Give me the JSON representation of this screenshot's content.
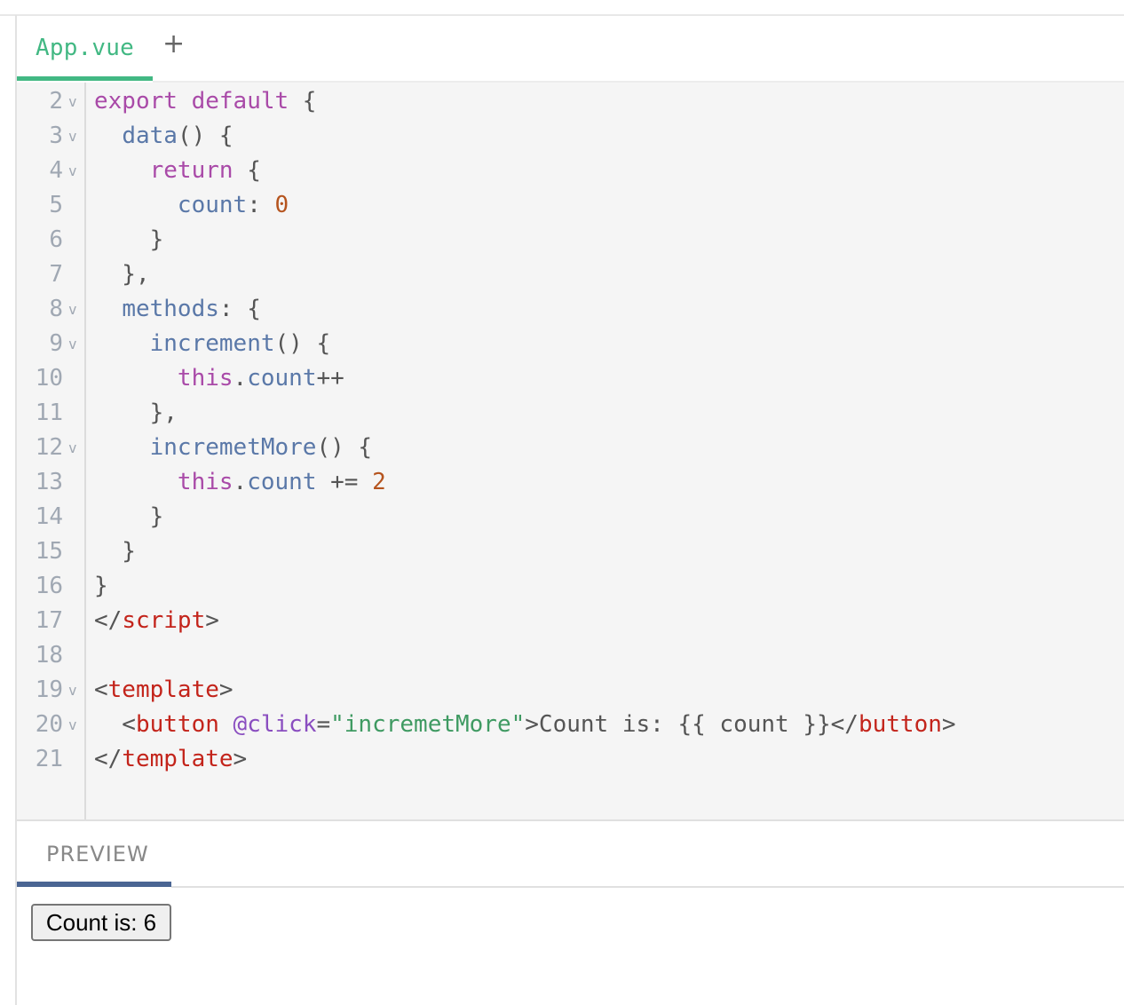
{
  "tabs": {
    "file_label": "App.vue",
    "add_label": "+"
  },
  "editor": {
    "lines": [
      {
        "num": "2",
        "fold": "v",
        "tokens": [
          [
            "kw",
            "export"
          ],
          [
            "p",
            " "
          ],
          [
            "kw",
            "default"
          ],
          [
            "p",
            " {"
          ]
        ]
      },
      {
        "num": "3",
        "fold": "v",
        "tokens": [
          [
            "p",
            "  "
          ],
          [
            "fn",
            "data"
          ],
          [
            "p",
            "() {"
          ]
        ]
      },
      {
        "num": "4",
        "fold": "v",
        "tokens": [
          [
            "p",
            "    "
          ],
          [
            "kw",
            "return"
          ],
          [
            "p",
            " {"
          ]
        ]
      },
      {
        "num": "5",
        "fold": "",
        "tokens": [
          [
            "p",
            "      "
          ],
          [
            "fn",
            "count"
          ],
          [
            "p",
            ": "
          ],
          [
            "num",
            "0"
          ]
        ]
      },
      {
        "num": "6",
        "fold": "",
        "tokens": [
          [
            "p",
            "    }"
          ]
        ]
      },
      {
        "num": "7",
        "fold": "",
        "tokens": [
          [
            "p",
            "  },"
          ]
        ]
      },
      {
        "num": "8",
        "fold": "v",
        "tokens": [
          [
            "p",
            "  "
          ],
          [
            "fn",
            "methods"
          ],
          [
            "p",
            ": {"
          ]
        ]
      },
      {
        "num": "9",
        "fold": "v",
        "tokens": [
          [
            "p",
            "    "
          ],
          [
            "fn",
            "increment"
          ],
          [
            "p",
            "() {"
          ]
        ]
      },
      {
        "num": "10",
        "fold": "",
        "tokens": [
          [
            "p",
            "      "
          ],
          [
            "kw",
            "this"
          ],
          [
            "p",
            "."
          ],
          [
            "fn",
            "count"
          ],
          [
            "p",
            "++"
          ]
        ]
      },
      {
        "num": "11",
        "fold": "",
        "tokens": [
          [
            "p",
            "    },"
          ]
        ]
      },
      {
        "num": "12",
        "fold": "v",
        "tokens": [
          [
            "p",
            "    "
          ],
          [
            "fn",
            "incremetMore"
          ],
          [
            "p",
            "() {"
          ]
        ]
      },
      {
        "num": "13",
        "fold": "",
        "tokens": [
          [
            "p",
            "      "
          ],
          [
            "kw",
            "this"
          ],
          [
            "p",
            "."
          ],
          [
            "fn",
            "count"
          ],
          [
            "p",
            " += "
          ],
          [
            "num",
            "2"
          ]
        ]
      },
      {
        "num": "14",
        "fold": "",
        "tokens": [
          [
            "p",
            "    }"
          ]
        ]
      },
      {
        "num": "15",
        "fold": "",
        "tokens": [
          [
            "p",
            "  }"
          ]
        ]
      },
      {
        "num": "16",
        "fold": "",
        "tokens": [
          [
            "p",
            "}"
          ]
        ]
      },
      {
        "num": "17",
        "fold": "",
        "tokens": [
          [
            "p",
            "</"
          ],
          [
            "tag",
            "script"
          ],
          [
            "p",
            ">"
          ]
        ]
      },
      {
        "num": "18",
        "fold": "",
        "tokens": []
      },
      {
        "num": "19",
        "fold": "v",
        "tokens": [
          [
            "p",
            "<"
          ],
          [
            "tag",
            "template"
          ],
          [
            "p",
            ">"
          ]
        ]
      },
      {
        "num": "20",
        "fold": "v",
        "tokens": [
          [
            "p",
            "  <"
          ],
          [
            "tag",
            "button"
          ],
          [
            "p",
            " "
          ],
          [
            "attr",
            "@click"
          ],
          [
            "p",
            "="
          ],
          [
            "str",
            "\"incremetMore\""
          ],
          [
            "p",
            ">Count is: {{ count }}</"
          ],
          [
            "tag",
            "button"
          ],
          [
            "p",
            ">"
          ]
        ]
      },
      {
        "num": "21",
        "fold": "",
        "tokens": [
          [
            "p",
            "</"
          ],
          [
            "tag",
            "template"
          ],
          [
            "p",
            ">"
          ]
        ]
      }
    ]
  },
  "preview": {
    "tab_label": "PREVIEW",
    "button_label": "Count is: 6"
  }
}
